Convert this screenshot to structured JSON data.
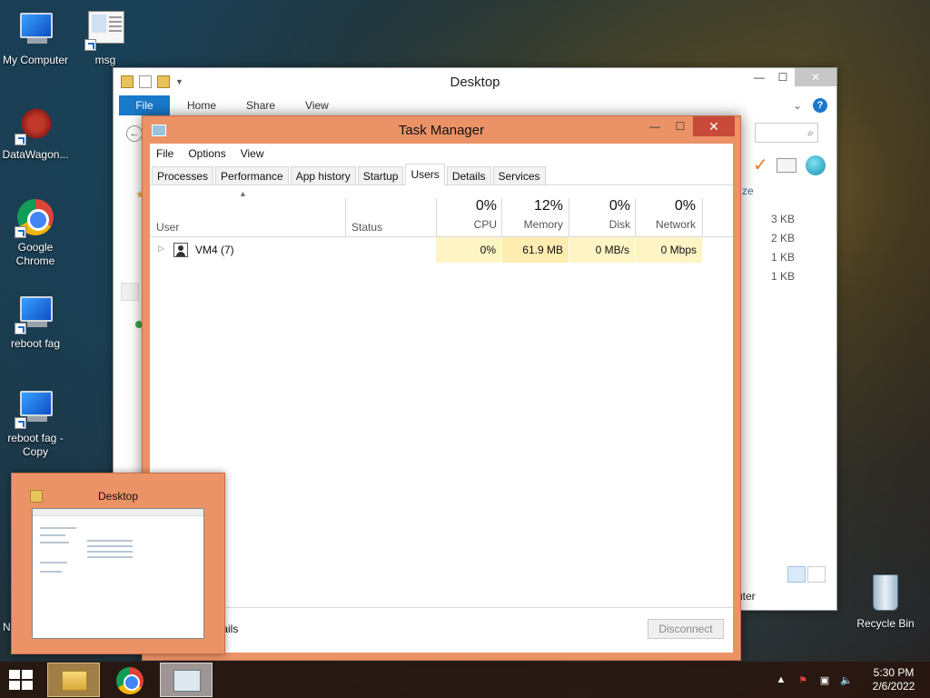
{
  "desktop": {
    "icons": [
      {
        "label": "My Computer"
      },
      {
        "label": "msg"
      },
      {
        "label": "DataWagon..."
      },
      {
        "label": "Google Chrome"
      },
      {
        "label": "reboot fag"
      },
      {
        "label": "reboot fag - Copy"
      },
      {
        "label": "Recycle Bin"
      }
    ],
    "partial_left_text": "N"
  },
  "explorer": {
    "title": "Desktop",
    "ribbon_tabs": [
      "File",
      "Home",
      "Share",
      "View"
    ],
    "size_header_fragment": "ze",
    "sizes": [
      "3 KB",
      "2 KB",
      "1 KB",
      "1 KB"
    ],
    "status_fragment": "uter",
    "search_icon": "search-icon"
  },
  "task_manager": {
    "title": "Task Manager",
    "menu": [
      "File",
      "Options",
      "View"
    ],
    "tabs": [
      "Processes",
      "Performance",
      "App history",
      "Startup",
      "Users",
      "Details",
      "Services"
    ],
    "active_tab": "Users",
    "columns": {
      "user": "User",
      "status": "Status",
      "cpu": {
        "pct": "0%",
        "label": "CPU"
      },
      "memory": {
        "pct": "12%",
        "label": "Memory"
      },
      "disk": {
        "pct": "0%",
        "label": "Disk"
      },
      "network": {
        "pct": "0%",
        "label": "Network"
      }
    },
    "rows": [
      {
        "user": "VM4 (7)",
        "status": "",
        "cpu": "0%",
        "memory": "61.9 MB",
        "disk": "0 MB/s",
        "network": "0 Mbps"
      }
    ],
    "fewer_details": "tails",
    "disconnect": "Disconnect"
  },
  "thumbnail": {
    "title": "Desktop"
  },
  "taskbar": {
    "time": "5:30 PM",
    "date": "2/6/2022",
    "tray_chevron": "▲"
  }
}
